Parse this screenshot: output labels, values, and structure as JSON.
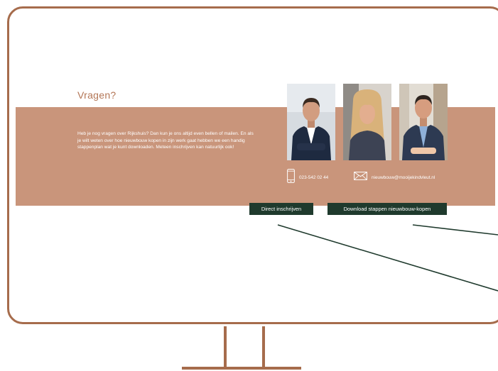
{
  "section": {
    "heading": "Vragen?",
    "body": "Heb je nog vragen over Rijkshuis? Dan kun je ons altijd even bellen of mailen. En als je wilt weten over hoe nieuwbouw kopen in zijn werk gaat hebben we een handig stappenplan wat je kunt downloaden. Meteen inschrijven kan natuurlijk ook!"
  },
  "contact": {
    "phone": "023-542 02 44",
    "email": "nieuwbouw@mooijekindvleut.nl"
  },
  "buttons": {
    "register": "Direct inschrijven",
    "download": "Download stappen nieuwbouw-kopen"
  },
  "colors": {
    "band": "#c9957b",
    "heading": "#b37656",
    "button": "#1f3a2d",
    "frame": "#a66c4c"
  },
  "icons": [
    "phone-icon",
    "mail-icon"
  ]
}
